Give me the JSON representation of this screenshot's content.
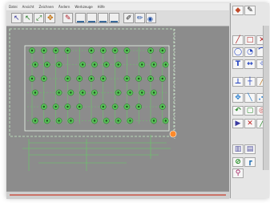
{
  "menu": {
    "items": [
      "Datei",
      "Ansicht",
      "Zeichnen",
      "Ändern",
      "Werkzeuge",
      "Hilfe"
    ]
  },
  "toolbar": {
    "tools": [
      "select-arrow",
      "move-tool",
      "scale-tool",
      "rotate-tool",
      "pen-tool",
      "align-left-tool",
      "align-center-tool",
      "align-right-tool",
      "distribute-tool",
      "brush-tool",
      "pencil-tool",
      "eye-tool"
    ]
  },
  "palette": {
    "tools": [
      "layer-tool",
      "pencil-tool",
      "line-tool",
      "rectangle-tool",
      "x-tool",
      "circle-tool",
      "arc-tool",
      "curve-tool",
      "text-tool",
      "dimension-tool",
      "measure-tool",
      "move-tool",
      "trim-tool",
      "stretch-tool",
      "split-tool",
      "copy-tool",
      "offset-tool",
      "mirror-tool",
      "cross-tool",
      "hatch-tool",
      "fill-tool",
      "layer-settings-tool",
      "pipe-tool",
      "zoom-tool"
    ]
  },
  "colors": {
    "canvas_bg": "#8c8c8c",
    "trace_green": "#63d063",
    "node_green": "#58c058",
    "accent_orange": "#ff8a2a",
    "accent_red": "#c84a3a"
  }
}
